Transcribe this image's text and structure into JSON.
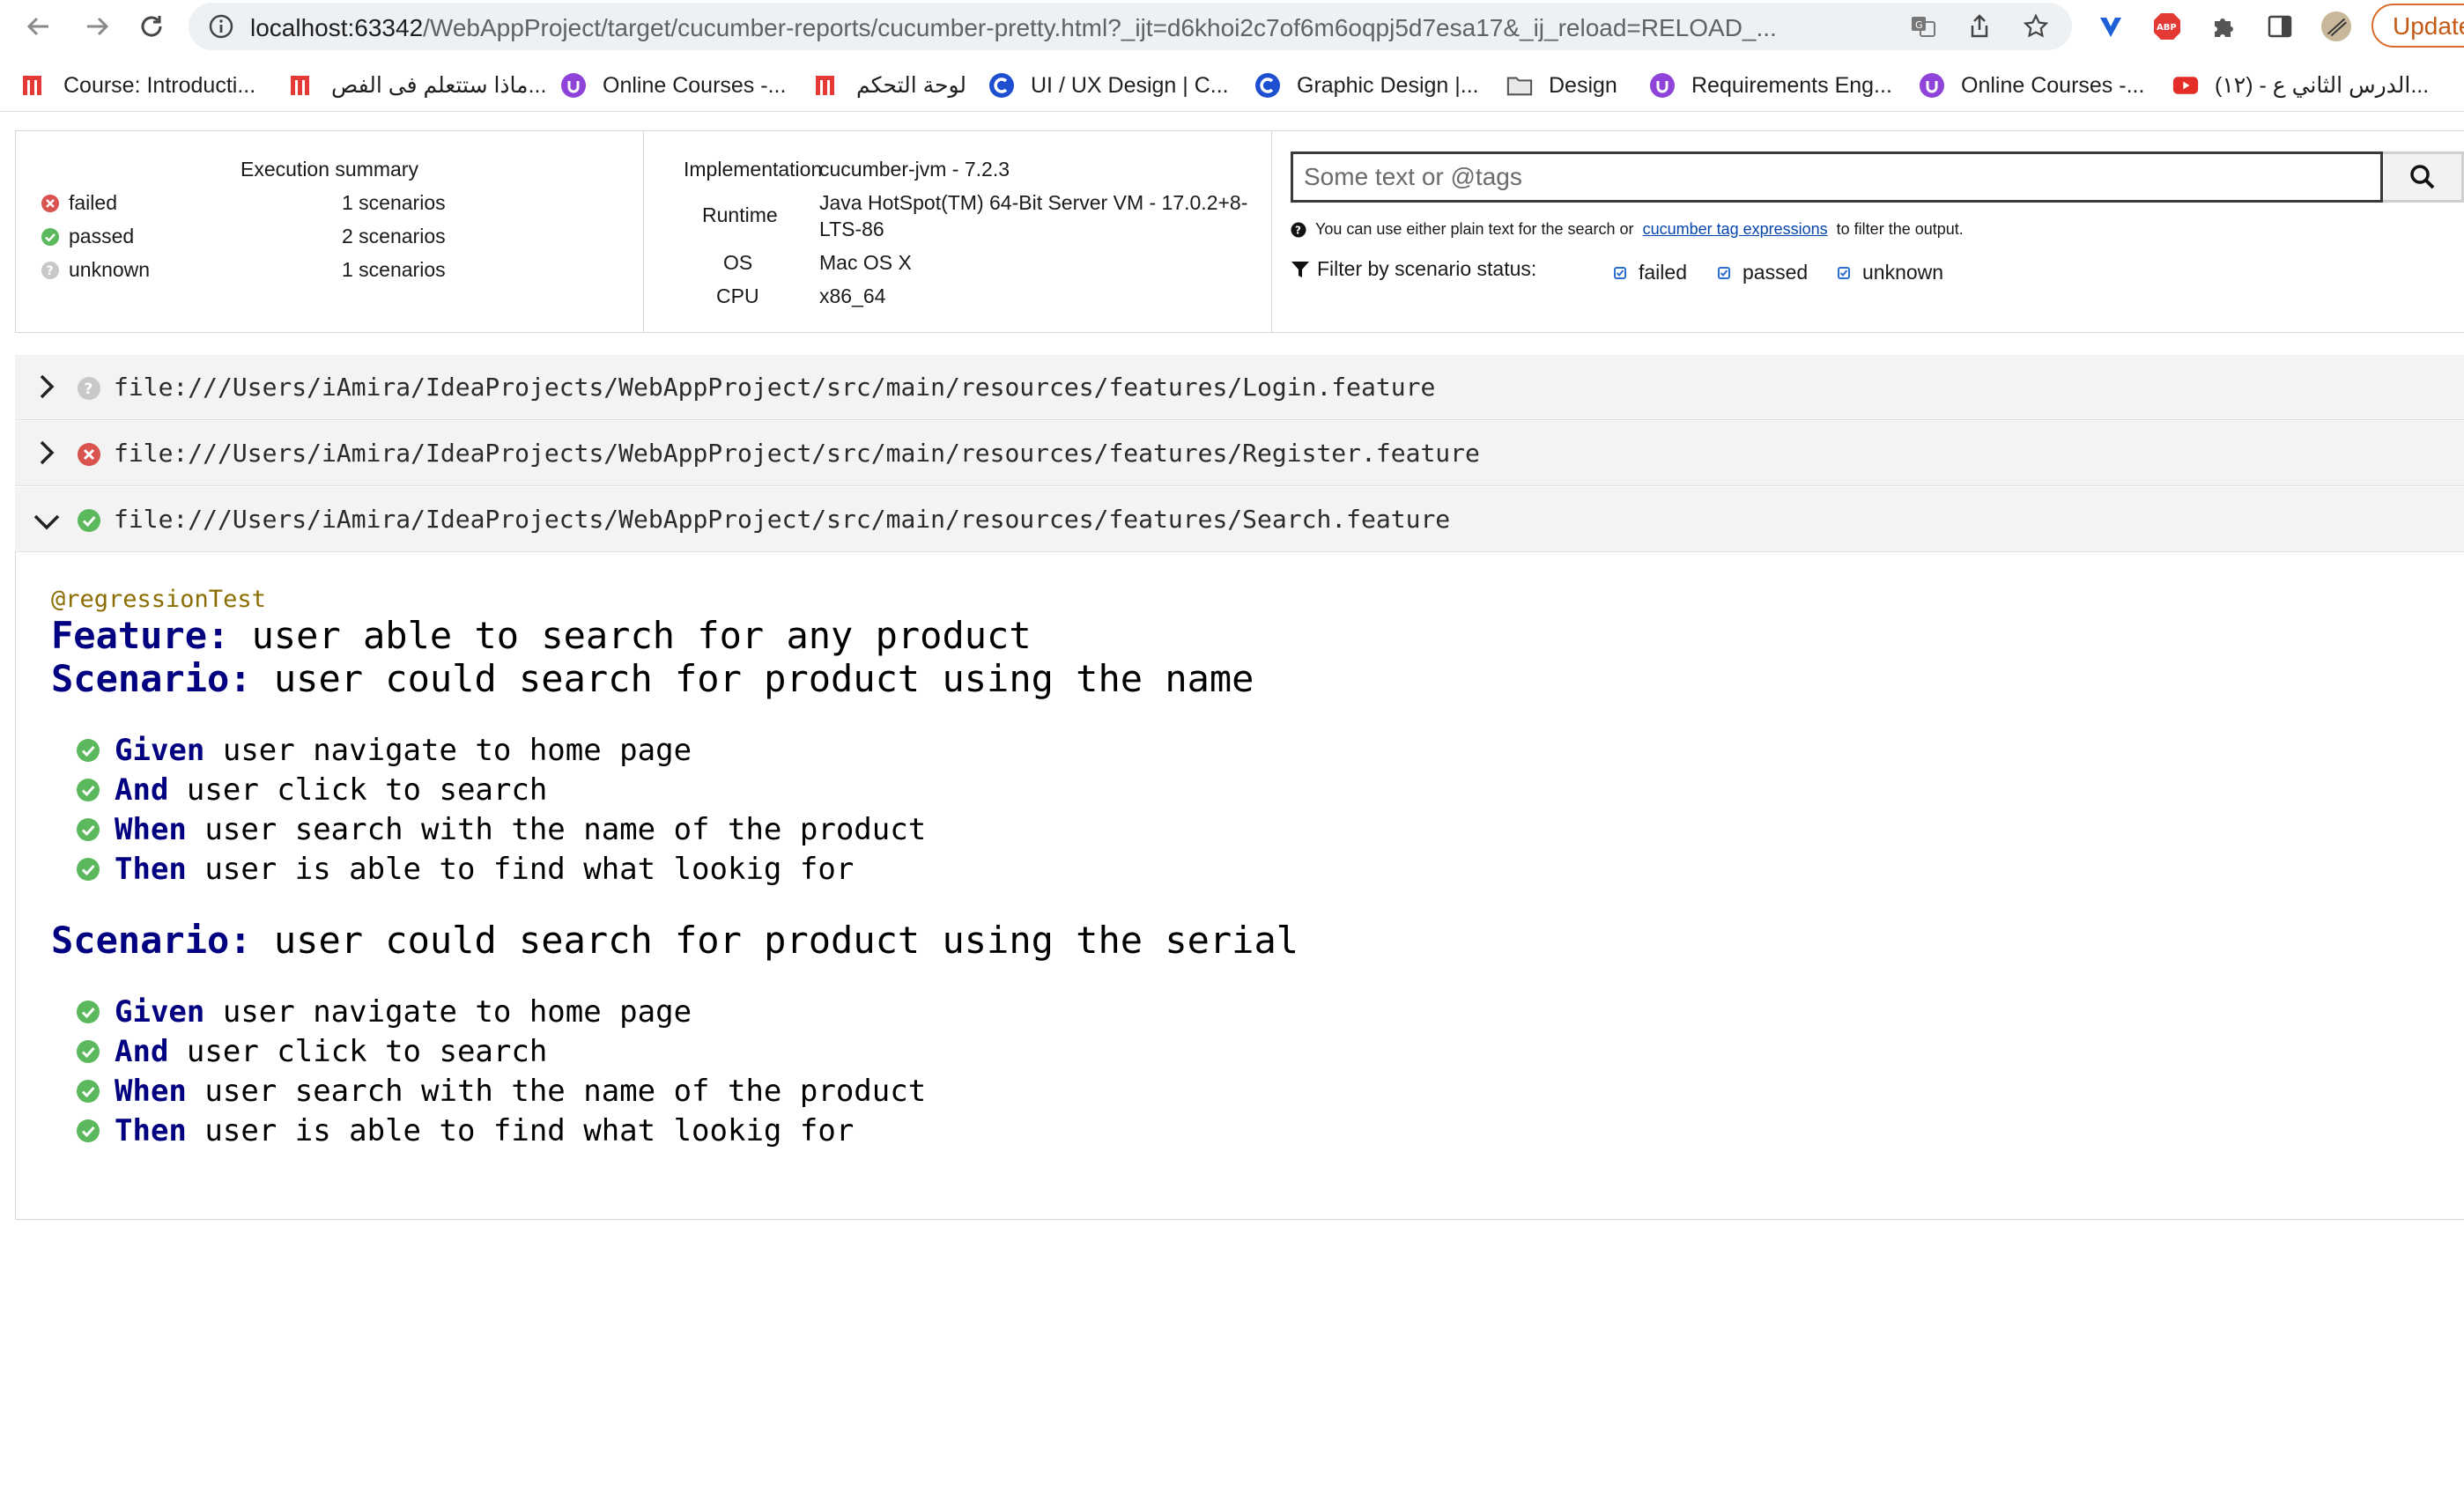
{
  "browser": {
    "url_host": "localhost:63342",
    "url_rest": "/WebAppProject/target/cucumber-reports/cucumber-pretty.html?_ijt=d6khoi2c7of6m6oqpj5d7esa17&_ij_reload=RELOAD_...",
    "update_label": "Update",
    "extension_abp_label": "ABP"
  },
  "bookmarks": [
    {
      "label": "Course: Introducti...",
      "icon": "m-logo-icon"
    },
    {
      "label": "ماذا ستتعلم فى الفص...",
      "icon": "m-logo-icon"
    },
    {
      "label": "Online Courses -...",
      "icon": "udemy-icon"
    },
    {
      "label": "لوحة التحكم",
      "icon": "m-logo-icon"
    },
    {
      "label": "UI / UX Design | C...",
      "icon": "c-logo-icon"
    },
    {
      "label": "Graphic Design |...",
      "icon": "c-logo-icon"
    },
    {
      "label": "Design",
      "icon": "folder-icon"
    },
    {
      "label": "Requirements Eng...",
      "icon": "udemy-icon"
    },
    {
      "label": "Online Courses -...",
      "icon": "udemy-icon"
    },
    {
      "label": "(١٢) - الدرس الثاني ع...",
      "icon": "youtube-icon"
    }
  ],
  "summary": {
    "title": "Execution summary",
    "rows": [
      {
        "status": "failed",
        "count": "1 scenarios"
      },
      {
        "status": "passed",
        "count": "2 scenarios"
      },
      {
        "status": "unknown",
        "count": "1 scenarios"
      }
    ]
  },
  "environment": {
    "implementation_key": "Implementation",
    "implementation_val": "cucumber-jvm - 7.2.3",
    "runtime_key": "Runtime",
    "runtime_val_1": "Java HotSpot(TM) 64-Bit Server VM - 17.0.2+8-",
    "runtime_val_2": "LTS-86",
    "os_key": "OS",
    "os_val": "Mac OS X",
    "cpu_key": "CPU",
    "cpu_val": "x86_64"
  },
  "search": {
    "placeholder": "Some text or @tags",
    "help_prefix": "You can use either plain text for the search or",
    "help_link": "cucumber tag expressions",
    "help_suffix": "to filter the output.",
    "filter_label": "Filter by scenario status:",
    "filters": [
      "failed",
      "passed",
      "unknown"
    ]
  },
  "features": [
    {
      "path": "file:///Users/iAmira/IdeaProjects/WebAppProject/src/main/resources/features/Login.feature",
      "status": "unknown",
      "expanded": false
    },
    {
      "path": "file:///Users/iAmira/IdeaProjects/WebAppProject/src/main/resources/features/Register.feature",
      "status": "failed",
      "expanded": false
    },
    {
      "path": "file:///Users/iAmira/IdeaProjects/WebAppProject/src/main/resources/features/Search.feature",
      "status": "passed",
      "expanded": true
    }
  ],
  "search_feature": {
    "tag": "@regressionTest",
    "feature_kw": "Feature:",
    "feature_name": "user able to search for any product",
    "scenarios": [
      {
        "kw": "Scenario:",
        "name": "user could search for product using the name",
        "steps": [
          {
            "kw": "Given",
            "text": "user navigate to home page"
          },
          {
            "kw": "And",
            "text": "user click to search"
          },
          {
            "kw": "When",
            "text": "user search with the name of the product"
          },
          {
            "kw": "Then",
            "text": "user is able to find what lookig for"
          }
        ]
      },
      {
        "kw": "Scenario:",
        "name": "user could search for product using the serial",
        "steps": [
          {
            "kw": "Given",
            "text": "user navigate to home page"
          },
          {
            "kw": "And",
            "text": "user click to search"
          },
          {
            "kw": "When",
            "text": "user search with the name of the product"
          },
          {
            "kw": "Then",
            "text": "user is able to find what lookig for"
          }
        ]
      }
    ]
  },
  "colors": {
    "passed": "#5cb85c",
    "failed": "#d9534f",
    "unknown": "#c8c8c8",
    "keyword": "#000080",
    "tag": "#8b6d00"
  }
}
